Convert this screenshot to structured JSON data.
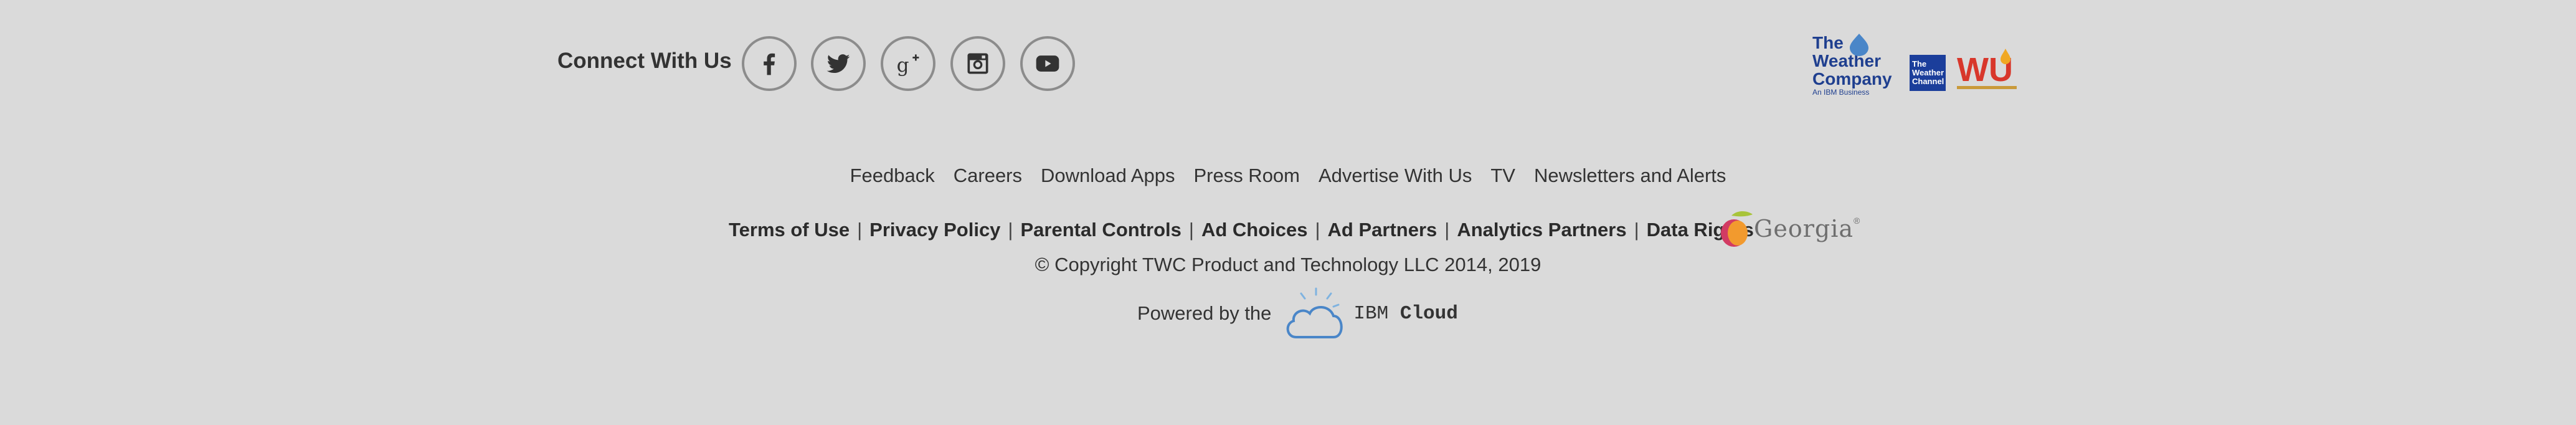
{
  "connect": {
    "label": "Connect With Us",
    "icons": [
      "facebook-icon",
      "twitter-icon",
      "google-plus-icon",
      "instagram-icon",
      "youtube-icon"
    ]
  },
  "nav": {
    "links": [
      "Feedback",
      "Careers",
      "Download Apps",
      "Press Room",
      "Advertise With Us",
      "TV",
      "Newsletters and Alerts"
    ]
  },
  "legal": {
    "links": [
      "Terms of Use",
      "Privacy Policy",
      "Parental Controls",
      "Ad Choices",
      "Ad Partners",
      "Analytics Partners",
      "Data Rights"
    ]
  },
  "copyright": "© Copyright TWC Product and Technology LLC 2014, 2019",
  "powered": {
    "label": "Powered by the",
    "brand_prefix": "IBM",
    "brand_name": "Cloud"
  },
  "brands": {
    "twc_line1": "The",
    "twc_line2": "Weather",
    "twc_line3": "Company",
    "twc_sub": "An IBM Business",
    "channel_line1": "The",
    "channel_line2": "Weather",
    "channel_line3": "Channel",
    "wu_text": "WU",
    "georgia": "Georgia",
    "georgia_mark": "®"
  },
  "colors": {
    "background": "#dadada",
    "icon_border": "#8c8c8c",
    "twc_blue": "#1f3f8f",
    "cloud_blue": "#4a86c8"
  }
}
